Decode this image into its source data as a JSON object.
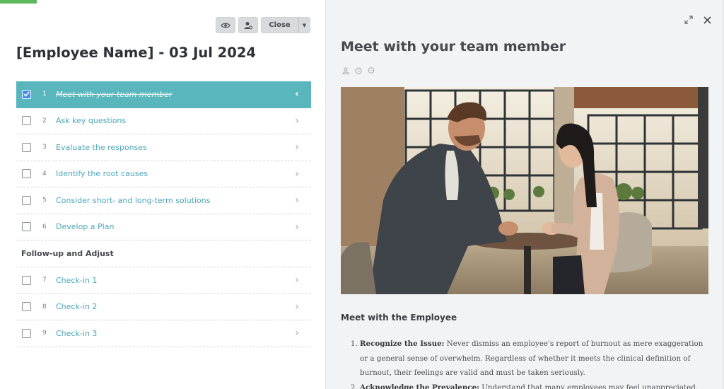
{
  "left": {
    "toolbar": {
      "close_label": "Close",
      "icons": [
        "eye-icon",
        "user-settings-icon",
        "caret-down-icon"
      ]
    },
    "title": "[Employee Name] - 03 Jul 2024",
    "progress_fraction": 0.11,
    "steps": [
      {
        "num": "1",
        "label": "Meet with your team member",
        "checked": true,
        "active": true
      },
      {
        "num": "2",
        "label": "Ask key questions",
        "checked": false
      },
      {
        "num": "3",
        "label": "Evaluate the responses",
        "checked": false
      },
      {
        "num": "4",
        "label": "Identify the root causes",
        "checked": false
      },
      {
        "num": "5",
        "label": "Consider short- and long-term solutions",
        "checked": false
      },
      {
        "num": "6",
        "label": "Develop a Plan",
        "checked": false
      }
    ],
    "section_title": "Follow-up and Adjust",
    "followup_steps": [
      {
        "num": "7",
        "label": "Check-in 1",
        "checked": false
      },
      {
        "num": "8",
        "label": "Check-in 2",
        "checked": false
      },
      {
        "num": "9",
        "label": "Check-in 3",
        "checked": false
      }
    ]
  },
  "right": {
    "title": "Meet with your team member",
    "subheading": "Meet with the Employee",
    "items": [
      {
        "bold": "Recognize the Issue:",
        "text": " Never dismiss an employee's report of burnout as mere exaggeration or a general sense of overwhelm. Regardless of whether it meets the clinical definition of burnout, their feelings are valid and must be taken seriously."
      },
      {
        "bold": "Acknowledge the Prevalence:",
        "text": " Understand that many employees may feel unappreciated."
      }
    ]
  },
  "colors": {
    "accent": "#5ab6bd",
    "link": "#4aa6b8",
    "checkbox_checked": "#3f8ee8",
    "progress": "#5cb85c"
  }
}
